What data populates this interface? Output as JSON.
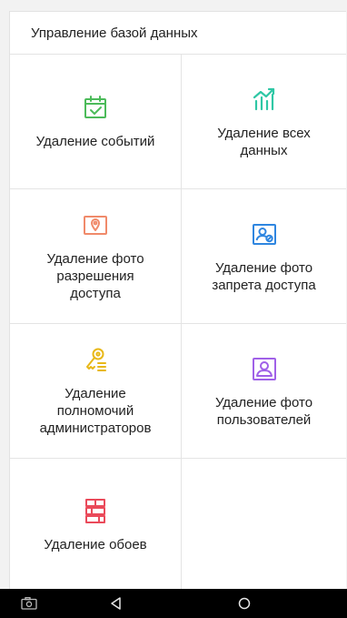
{
  "header": {
    "title": "Управление базой данных"
  },
  "tiles": [
    {
      "label": "Удаление событий",
      "icon": "calendar-check-icon",
      "color": "#4cbb5a"
    },
    {
      "label": "Удаление всех\nданных",
      "icon": "chart-growth-icon",
      "color": "#2fc7a5"
    },
    {
      "label": "Удаление фото\nразрешения\nдоступа",
      "icon": "photo-location-icon",
      "color": "#f08a6a"
    },
    {
      "label": "Удаление фото\nзапрета доступа",
      "icon": "photo-person-block-icon",
      "color": "#2f86e0"
    },
    {
      "label": "Удаление\nполномочий\nадминистраторов",
      "icon": "admin-key-icon",
      "color": "#e8b818"
    },
    {
      "label": "Удаление фото\nпользователей",
      "icon": "user-photo-icon",
      "color": "#a061e8"
    },
    {
      "label": "Удаление обоев",
      "icon": "wallpaper-icon",
      "color": "#ea4a5a"
    }
  ],
  "navbar": {
    "icons": [
      "screenshot-icon",
      "back-icon",
      "home-icon"
    ]
  }
}
